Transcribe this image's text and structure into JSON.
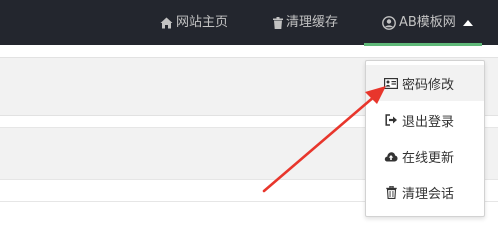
{
  "header": {
    "nav": {
      "home_label": "网站主页",
      "cache_label": "清理缓存",
      "user_label": "AB模板网"
    },
    "accent_color": "#5fb878",
    "bar_color": "#23262e"
  },
  "user_menu": {
    "items": [
      {
        "label": "密码修改",
        "icon": "id-card-icon"
      },
      {
        "label": "退出登录",
        "icon": "sign-out-icon"
      },
      {
        "label": "在线更新",
        "icon": "cloud-upload-icon"
      },
      {
        "label": "清理会话",
        "icon": "trash-icon"
      }
    ],
    "highlighted_item": "密码修改"
  },
  "annotation": {
    "arrow_color": "#e8362c",
    "points_to": "密码修改"
  }
}
